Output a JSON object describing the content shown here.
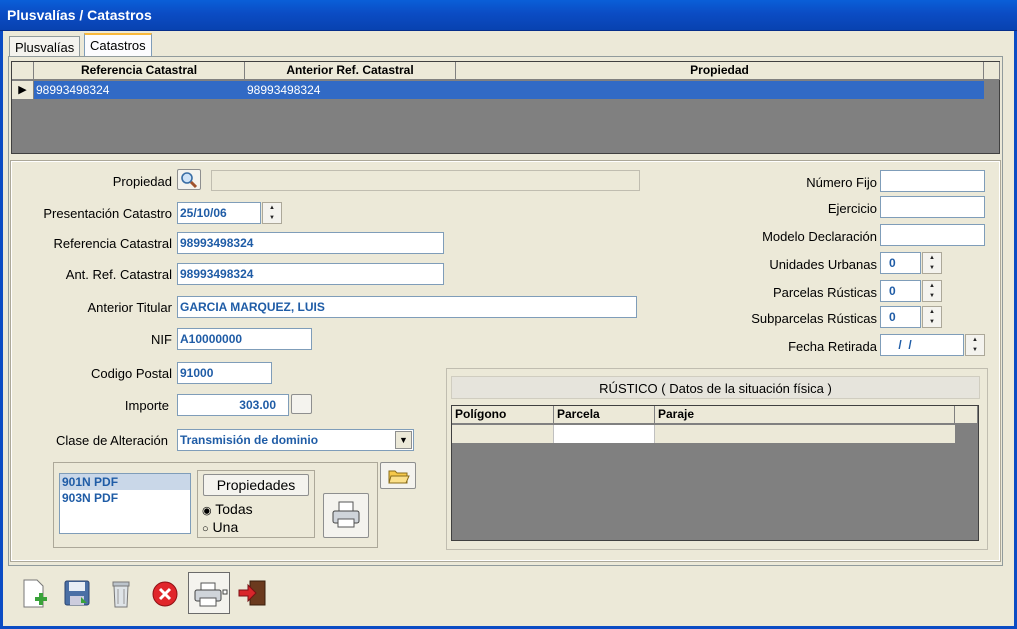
{
  "window": {
    "title": "Plusvalías / Catastros"
  },
  "tabs": [
    {
      "label": "Plusvalías"
    },
    {
      "label": "Catastros"
    }
  ],
  "grid": {
    "columns": [
      "Referencia Catastral",
      "Anterior Ref. Catastral",
      "Propiedad"
    ],
    "rows": [
      {
        "ref": "98993498324",
        "ant_ref": "98993498324",
        "propiedad": ""
      }
    ]
  },
  "form": {
    "propiedad_label": "Propiedad",
    "propiedad_value": "",
    "presentacion_label": "Presentación Catastro",
    "presentacion_value": "25/10/06",
    "referencia_label": "Referencia Catastral",
    "referencia_value": "98993498324",
    "ant_ref_label": "Ant. Ref. Catastral",
    "ant_ref_value": "98993498324",
    "anterior_titular_label": "Anterior Titular",
    "anterior_titular_value": "GARCIA MARQUEZ, LUIS",
    "nif_label": "NIF",
    "nif_value": "A10000000",
    "codigo_postal_label": "Codigo Postal",
    "codigo_postal_value": "91000",
    "importe_label": "Importe",
    "importe_value": "303.00",
    "clase_label": "Clase de Alteración",
    "clase_value": "Transmisión de dominio",
    "numero_fijo_label": "Número Fijo",
    "numero_fijo_value": "",
    "ejercicio_label": "Ejercicio",
    "ejercicio_value": "",
    "modelo_label": "Modelo Declaración",
    "modelo_value": "",
    "unidades_label": "Unidades Urbanas",
    "unidades_value": "0",
    "parcelas_label": "Parcelas Rústicas",
    "parcelas_value": "0",
    "subparcelas_label": "Subparcelas Rústicas",
    "subparcelas_value": "0",
    "fecha_retirada_label": "Fecha Retirada",
    "fecha_retirada_value": " /  /"
  },
  "print": {
    "docs": [
      "901N PDF",
      "903N PDF"
    ],
    "group_label": "Propiedades",
    "options": [
      "Todas",
      "Una"
    ],
    "selected": "Todas"
  },
  "rustico": {
    "title": "RÚSTICO ( Datos de la situación física )",
    "columns": [
      "Polígono",
      "Parcela",
      "Paraje"
    ]
  },
  "toolbar": [
    "new-doc-icon",
    "save-icon",
    "trash-icon",
    "close-red-icon",
    "printer-icon",
    "exit-icon"
  ]
}
